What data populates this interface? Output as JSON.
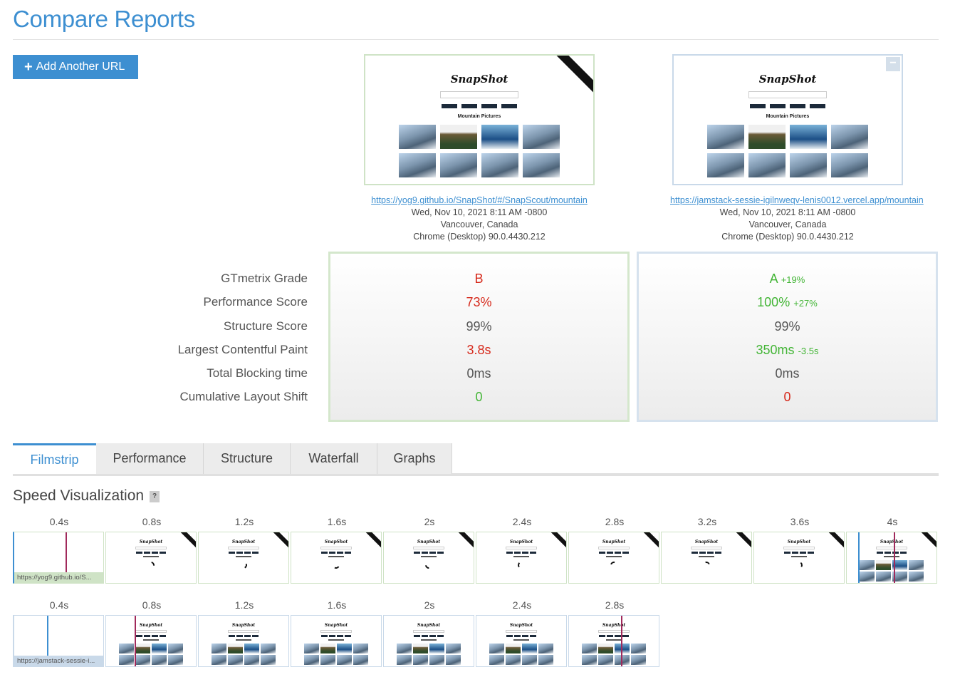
{
  "page": {
    "title": "Compare Reports"
  },
  "toolbar": {
    "add_url_label": "Add Another URL"
  },
  "reports": [
    {
      "url": "https://yog9.github.io/SnapShot/#/SnapScout/mountain",
      "date": "Wed, Nov 10, 2021 8:11 AM -0800",
      "location": "Vancouver, Canada",
      "browser": "Chrome (Desktop) 90.0.4430.212",
      "thumb_logo": "SnapShot",
      "thumb_search": "Search...",
      "thumb_subtitle": "Mountain Pictures",
      "metrics": {
        "grade": "B",
        "grade_delta": "",
        "performance": "73%",
        "performance_delta": "",
        "structure": "99%",
        "lcp": "3.8s",
        "lcp_delta": "",
        "tbt": "0ms",
        "cls": "0"
      }
    },
    {
      "url": "https://jamstack-sessie-igilnweqv-lenis0012.vercel.app/mountain",
      "date": "Wed, Nov 10, 2021 8:11 AM -0800",
      "location": "Vancouver, Canada",
      "browser": "Chrome (Desktop) 90.0.4430.212",
      "thumb_logo": "SnapShot",
      "thumb_search": "Search...",
      "thumb_subtitle": "Mountain Pictures",
      "metrics": {
        "grade": "A",
        "grade_delta": "+19%",
        "performance": "100%",
        "performance_delta": "+27%",
        "structure": "99%",
        "lcp": "350ms",
        "lcp_delta": "-3.5s",
        "tbt": "0ms",
        "cls": "0"
      }
    }
  ],
  "metric_labels": [
    "GTmetrix Grade",
    "Performance Score",
    "Structure Score",
    "Largest Contentful Paint",
    "Total Blocking time",
    "Cumulative Layout Shift"
  ],
  "tabs": [
    "Filmstrip",
    "Performance",
    "Structure",
    "Waterfall",
    "Graphs"
  ],
  "active_tab": "Filmstrip",
  "speed": {
    "title": "Speed Visualization",
    "help": "?"
  },
  "filmstrip_a": {
    "times": [
      "0.4s",
      "0.8s",
      "1.2s",
      "1.6s",
      "2s",
      "2.4s",
      "2.8s",
      "3.2s",
      "3.6s",
      "4s"
    ],
    "url_tag": "https://yog9.github.io/S..."
  },
  "filmstrip_b": {
    "times": [
      "0.4s",
      "0.8s",
      "1.2s",
      "1.6s",
      "2s",
      "2.4s",
      "2.8s"
    ],
    "url_tag": "https://jamstack-sessie-i..."
  },
  "colors": {
    "accent": "#3d8fd1",
    "good": "#43b536",
    "bad": "#d6291b",
    "marker": "#a0295b"
  }
}
